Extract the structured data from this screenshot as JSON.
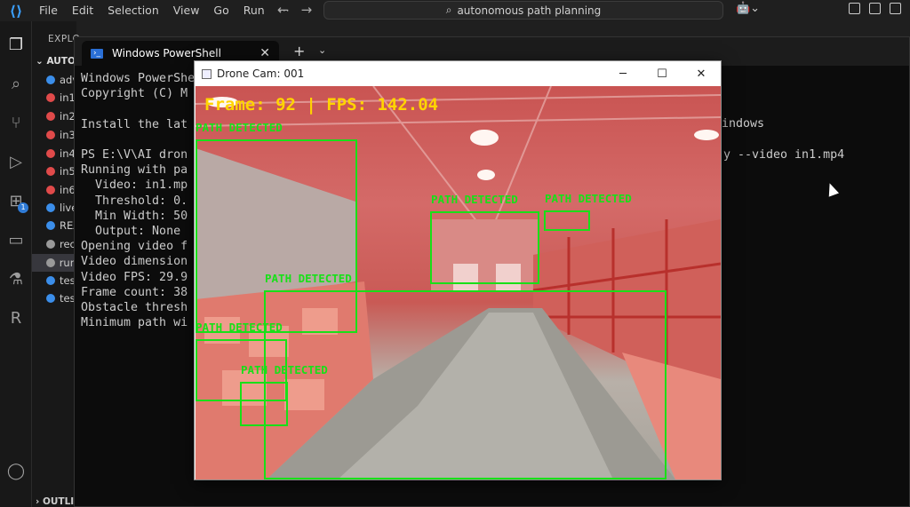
{
  "vscode": {
    "menu": [
      "File",
      "Edit",
      "Selection",
      "View",
      "Go",
      "Run",
      "···"
    ],
    "search_text": "autonomous path planning",
    "explorer_label": "EXPLO",
    "folder_label": "AUTO",
    "files": [
      {
        "name": "adv",
        "color": "#3b8eea"
      },
      {
        "name": "in1",
        "color": "#e04a4a"
      },
      {
        "name": "in2",
        "color": "#e04a4a"
      },
      {
        "name": "in3",
        "color": "#e04a4a"
      },
      {
        "name": "in4",
        "color": "#e04a4a"
      },
      {
        "name": "in5",
        "color": "#e04a4a"
      },
      {
        "name": "in6",
        "color": "#e04a4a"
      },
      {
        "name": "live",
        "color": "#3b8eea"
      },
      {
        "name": "REA",
        "color": "#3b8eea"
      },
      {
        "name": "rec",
        "color": "#999999"
      },
      {
        "name": "run",
        "color": "#999999"
      },
      {
        "name": "tes",
        "color": "#3b8eea"
      },
      {
        "name": "tes",
        "color": "#3b8eea"
      }
    ],
    "outline_label": "OUTLI",
    "extensions_badge": "1"
  },
  "powershell": {
    "tab_title": "Windows PowerShell",
    "lines": [
      "Windows PowerShe",
      "Copyright (C) M",
      "",
      "Install the lat",
      "",
      "PS E:\\V\\AI dron",
      "Running with pa",
      "  Video: in1.mp",
      "  Threshold: 0.",
      "  Min Width: 50",
      "  Output: None",
      "Opening video f",
      "Video dimension",
      "Video FPS: 29.9",
      "Frame count: 38",
      "Obstacle thresh",
      "Minimum path wi"
    ],
    "right_windows": "indows",
    "right_cmd": "y --video in1.mp4"
  },
  "drone_window": {
    "title": "Drone Cam: 001",
    "overlay": "Frame: 92 | FPS: 142.04",
    "detections": [
      {
        "label": "PATH DETECTED"
      },
      {
        "label": "PATH DETECTED"
      },
      {
        "label": "PATH DETECTED"
      },
      {
        "label": "PATH DETECTED"
      },
      {
        "label": "PATH DETECTED"
      },
      {
        "label": "PATH DETECTED"
      }
    ]
  },
  "colors": {
    "detection": "#18e018",
    "overlay_text": "#ffd400",
    "accent": "#3aa0ff"
  }
}
